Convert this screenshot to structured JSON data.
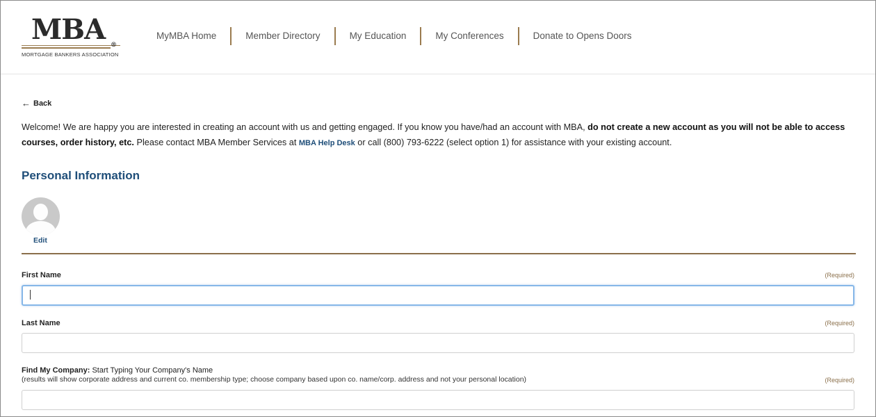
{
  "header": {
    "logo_text": "MBA",
    "logo_reg": "®",
    "logo_subtitle": "MORTGAGE BANKERS ASSOCIATION",
    "nav": [
      {
        "label": "MyMBA Home"
      },
      {
        "label": "Member Directory"
      },
      {
        "label": "My Education"
      },
      {
        "label": "My Conferences"
      },
      {
        "label": "Donate to Opens Doors"
      }
    ]
  },
  "back_label": "Back",
  "welcome": {
    "part1": "Welcome! We are happy you are interested in creating an account with us and getting engaged. If you know you have/had an account with MBA, ",
    "bold": "do not create a new account as you will not be able to access courses, order history, etc.",
    "part2": " Please contact MBA Member Services at ",
    "link": "MBA Help Desk",
    "part3": " or call (800) 793-6222 (select option 1) for assistance with your existing account."
  },
  "section_title": "Personal Information",
  "avatar_edit": "Edit",
  "fields": {
    "first_name": {
      "label": "First Name",
      "required": "(Required)",
      "value": ""
    },
    "last_name": {
      "label": "Last Name",
      "required": "(Required)",
      "value": ""
    },
    "company": {
      "label_bold": "Find My Company:",
      "label_rest": " Start Typing Your Company's Name",
      "help": "(results will show corporate address and current co. membership type; choose company based upon co. name/corp. address and not your personal location)",
      "required": "(Required)",
      "value": ""
    }
  },
  "colors": {
    "accent_gold": "#9a7b4f",
    "heading_blue": "#1f4e79",
    "focus_blue": "#86b7e8"
  }
}
